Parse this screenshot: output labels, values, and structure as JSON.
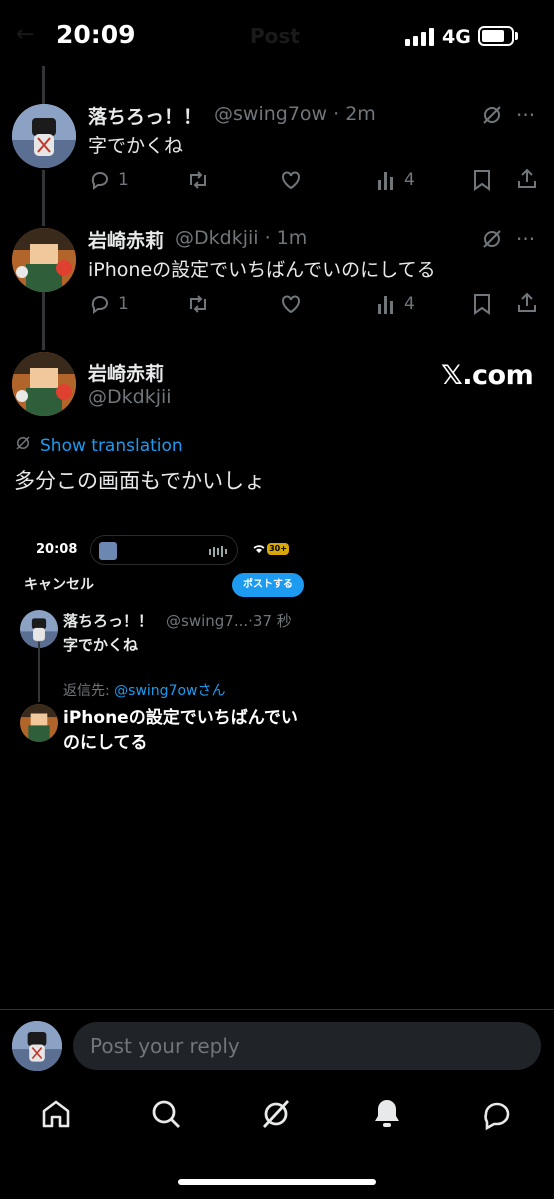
{
  "status_bar": {
    "time": "20:09",
    "network": "4G",
    "ghost_title": "Post",
    "ghost_back": "←"
  },
  "tweets": [
    {
      "author": "落ちろっ！！",
      "meta": "@swing7ow · 2m",
      "text": "字でかくね",
      "replies": "1",
      "views": "4"
    },
    {
      "author": "岩崎赤莉",
      "meta": "@Dkdkjii · 1m",
      "text": "iPhoneの設定でいちばんでいのにしてる",
      "replies": "1",
      "views": "4"
    }
  ],
  "main_post": {
    "author": "岩崎赤莉",
    "handle": "@Dkdkjii",
    "watermark": "𝕏.com",
    "translate_label": "Show translation",
    "text": "多分この画面もでかいしょ"
  },
  "embedded": {
    "time": "20:08",
    "battery": "30+",
    "cancel": "キャンセル",
    "post_button": "ポストする",
    "author": "落ちろっ！！",
    "meta": "@swing7...·37 秒",
    "text": "字でかくね",
    "reply_prefix": "返信先: ",
    "reply_handle": "@swing7owさん",
    "reply_text": "iPhoneの設定でいちばんでいのにしてる"
  },
  "composer": {
    "placeholder": "Post your reply"
  },
  "tabs": [
    "home",
    "search",
    "grok",
    "notifications",
    "messages"
  ],
  "colors": {
    "accent": "#1d9bf0",
    "muted": "#71767b",
    "background": "#000000"
  }
}
